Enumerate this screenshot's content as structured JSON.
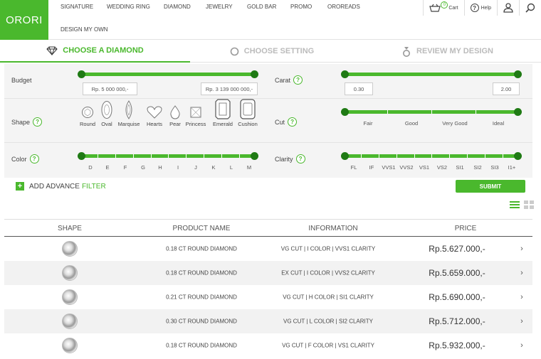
{
  "brand": {
    "logo": "ORORI",
    "accent": "#4ab82d",
    "accent_dark": "#1f7a14"
  },
  "nav": {
    "items": [
      "SIGNATURE",
      "WEDDING RING",
      "DIAMOND",
      "JEWELRY",
      "GOLD BAR",
      "PROMO",
      "OROREADS"
    ],
    "second_row": "DESIGN MY OWN"
  },
  "header_actions": {
    "cart_count": "0",
    "cart_label": "Cart",
    "help_label": "Help"
  },
  "steps": [
    "CHOOSE A DIAMOND",
    "CHOOSE SETTING",
    "REVIEW MY DESIGN"
  ],
  "filters": {
    "budget": {
      "label": "Budget",
      "min": "Rp. 5 000 000,-",
      "max": "Rp. 3 139 000 000,-"
    },
    "carat": {
      "label": "Carat",
      "help": "?",
      "min": "0.30",
      "max": "2.00"
    },
    "shape": {
      "label": "Shape",
      "help": "?",
      "options": [
        "Round",
        "Oval",
        "Marquise",
        "Hearts",
        "Pear",
        "Princess",
        "Emerald",
        "Cushion"
      ]
    },
    "cut": {
      "label": "Cut",
      "help": "?",
      "options": [
        "Fair",
        "Good",
        "Very Good",
        "Ideal"
      ]
    },
    "color": {
      "label": "Color",
      "help": "?",
      "options": [
        "D",
        "E",
        "F",
        "G",
        "H",
        "I",
        "J",
        "K",
        "L",
        "M"
      ]
    },
    "clarity": {
      "label": "Clarity",
      "help": "?",
      "options": [
        "FL",
        "IF",
        "VVS1",
        "VVS2",
        "VS1",
        "VS2",
        "SI1",
        "SI2",
        "SI3",
        "I1+"
      ]
    }
  },
  "advance": {
    "prefix": "ADD ADVANCE",
    "highlight": "FILTER",
    "plus": "+"
  },
  "submit_label": "SUBMIT",
  "table": {
    "headers": [
      "SHAPE",
      "PRODUCT NAME",
      "INFORMATION",
      "PRICE"
    ],
    "rows": [
      {
        "name": "0.18 CT ROUND DIAMOND",
        "info": "VG CUT | I COLOR | VVS1 CLARITY",
        "price": "Rp.5.627.000,-"
      },
      {
        "name": "0.18 CT ROUND DIAMOND",
        "info": "EX CUT | I COLOR | VVS2 CLARITY",
        "price": "Rp.5.659.000,-"
      },
      {
        "name": "0.21 CT ROUND DIAMOND",
        "info": "VG CUT | H COLOR | SI1 CLARITY",
        "price": "Rp.5.690.000,-"
      },
      {
        "name": "0.30 CT ROUND DIAMOND",
        "info": "VG CUT | L COLOR | SI2 CLARITY",
        "price": "Rp.5.712.000,-"
      },
      {
        "name": "0.18 CT ROUND DIAMOND",
        "info": "VG CUT | F COLOR | VS1 CLARITY",
        "price": "Rp.5.932.000,-"
      }
    ]
  }
}
